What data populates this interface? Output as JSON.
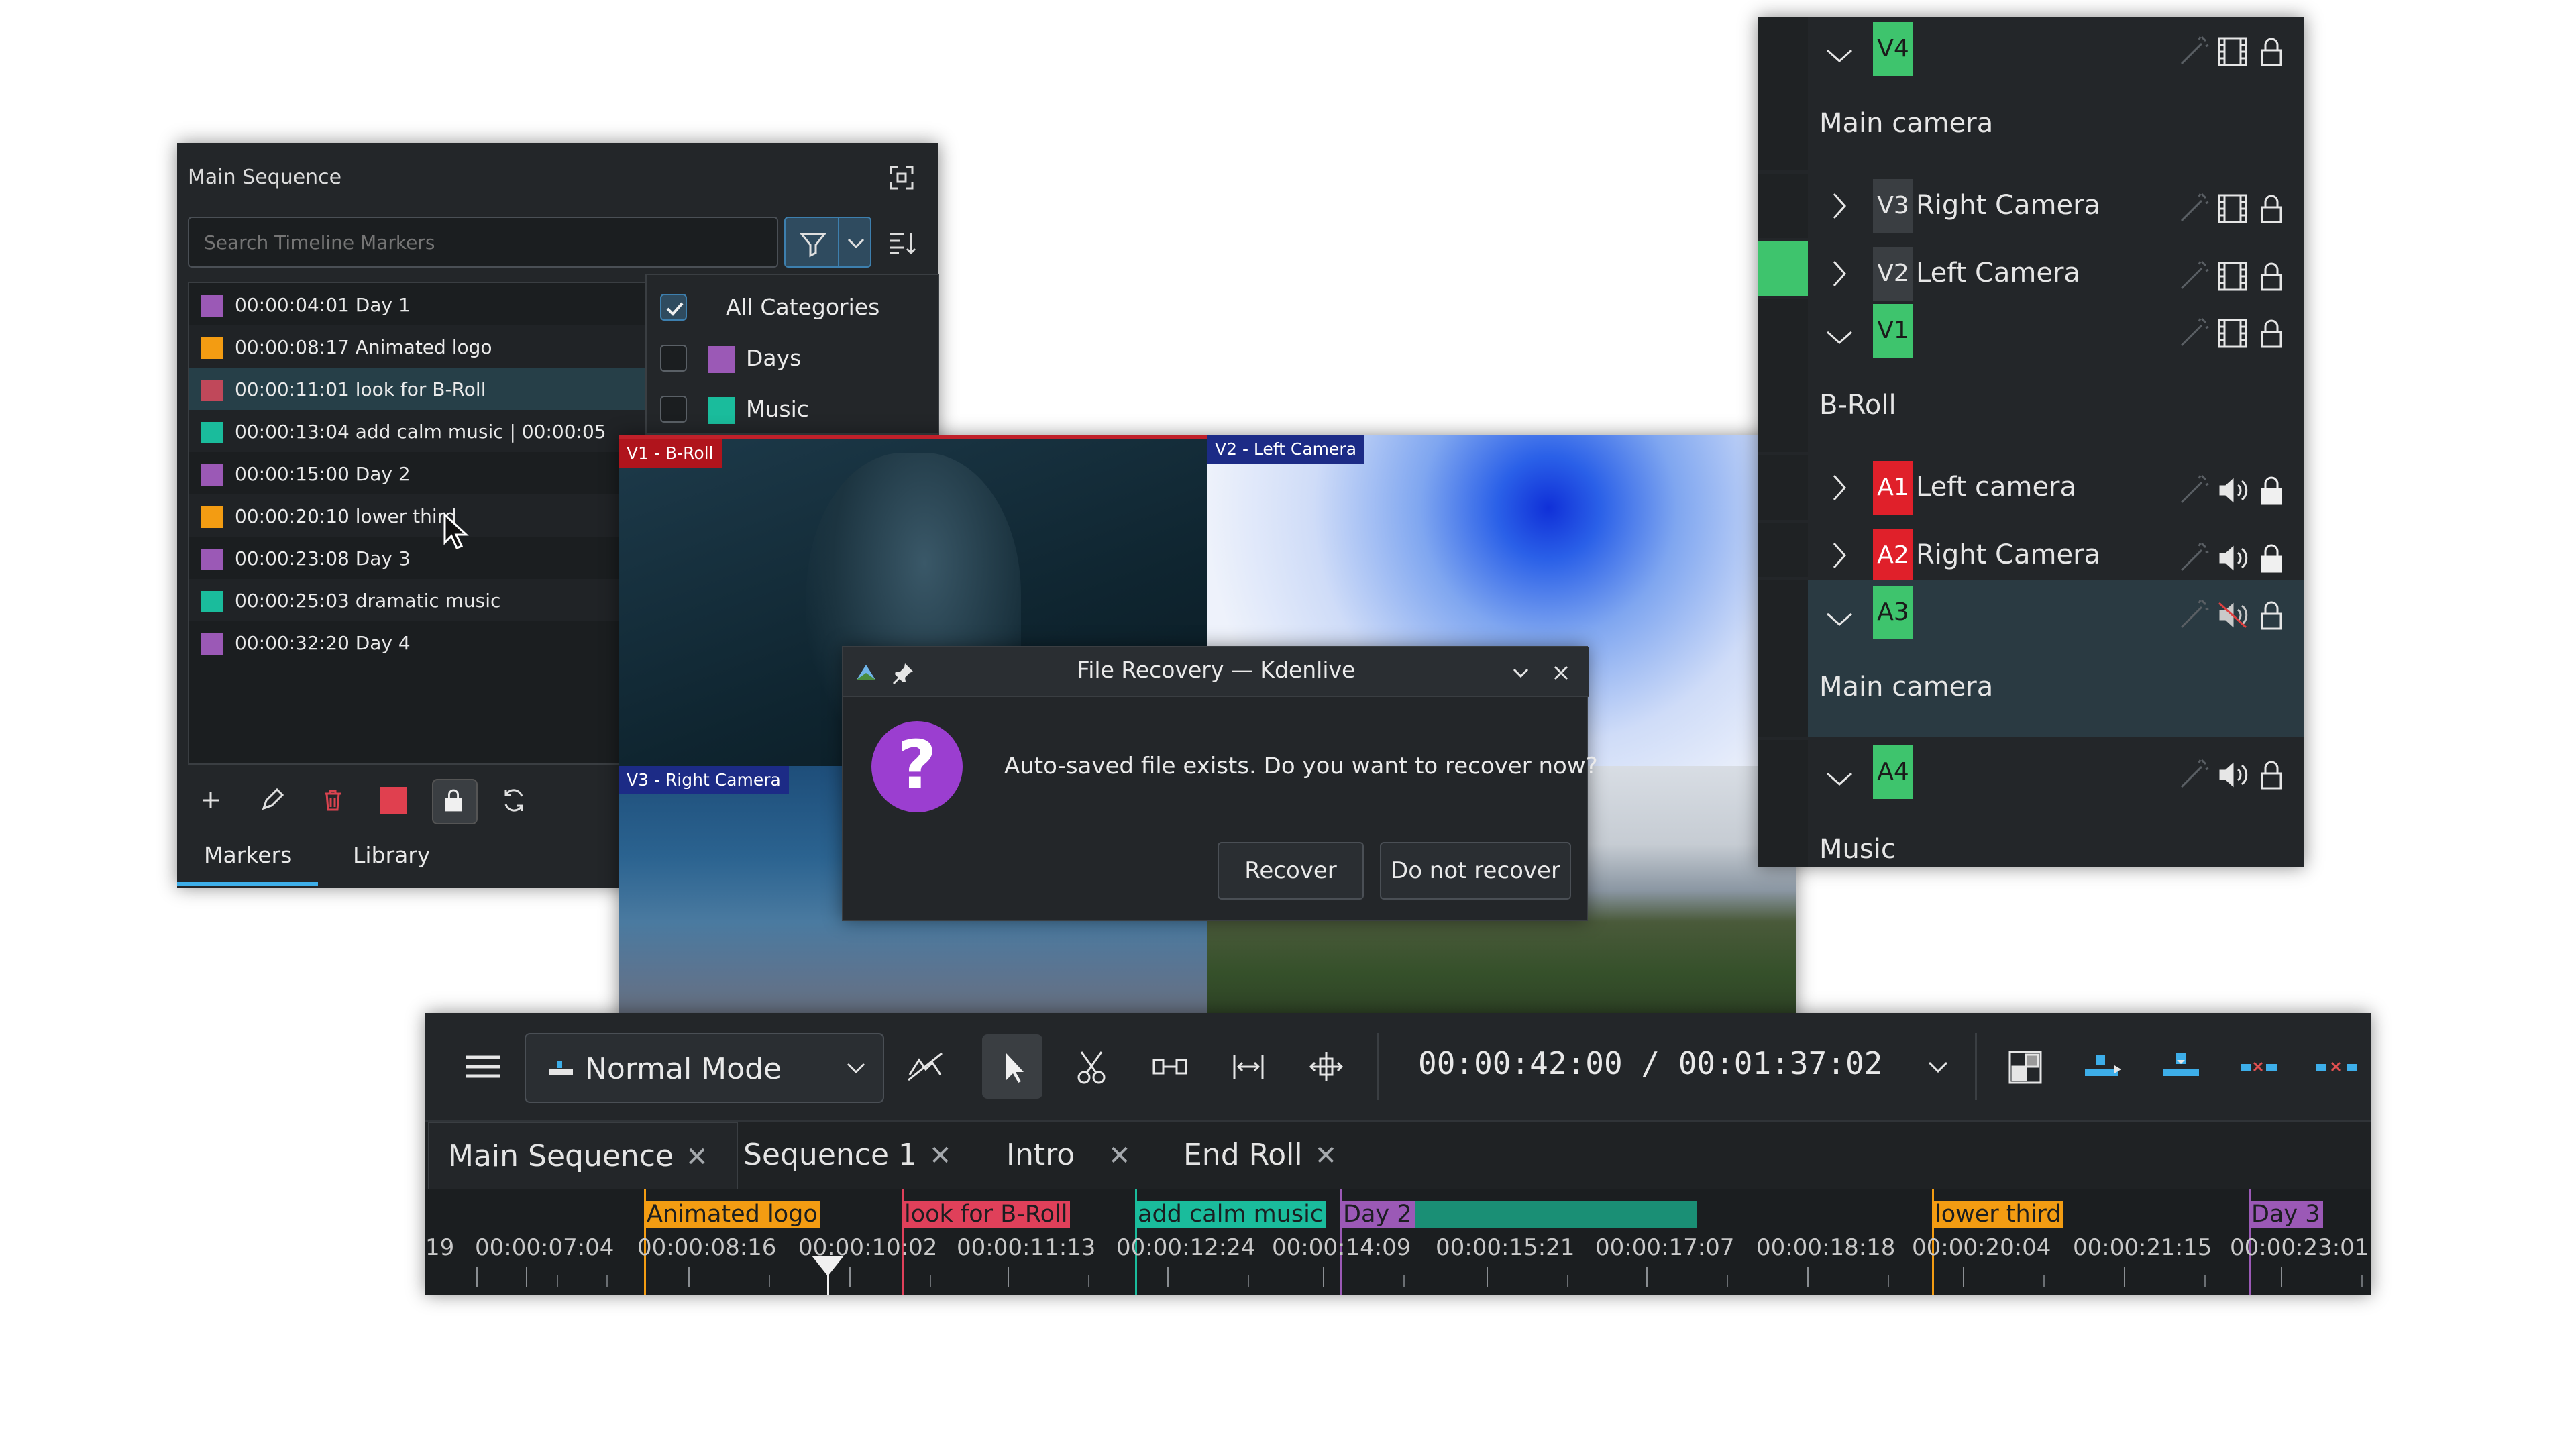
{
  "markers_panel": {
    "title": "Main Sequence",
    "search_placeholder": "Search Timeline Markers",
    "items": [
      {
        "label": "00:00:04:01 Day 1",
        "color": "#9b59b6"
      },
      {
        "label": "00:00:08:17 Animated logo",
        "color": "#f39c12"
      },
      {
        "label": "00:00:11:01 look for B-Roll",
        "color": "#c0485a"
      },
      {
        "label": "00:00:13:04 add calm music | 00:00:05",
        "color": "#1abc9c"
      },
      {
        "label": "00:00:15:00 Day 2",
        "color": "#9b59b6"
      },
      {
        "label": "00:00:20:10 lower third",
        "color": "#f39c12"
      },
      {
        "label": "00:00:23:08 Day 3",
        "color": "#9b59b6"
      },
      {
        "label": "00:00:25:03 dramatic music",
        "color": "#1abc9c"
      },
      {
        "label": "00:00:32:20 Day 4",
        "color": "#9b59b6"
      }
    ],
    "selected_index": 2,
    "tabs": [
      "Markers",
      "Library"
    ],
    "current_color": "#e0404f",
    "categories": [
      {
        "label": "All Categories",
        "checked": true,
        "color": ""
      },
      {
        "label": "Days",
        "checked": false,
        "color": "#9b59b6"
      },
      {
        "label": "Music",
        "checked": false,
        "color": "#1abc9c"
      }
    ]
  },
  "monitor": {
    "tiles": [
      "V1 - B-Roll",
      "V2 - Left Camera",
      "V3 - Right Camera"
    ]
  },
  "dialog": {
    "title": "File Recovery — Kdenlive",
    "message": "Auto-saved file exists. Do you want to recover now?",
    "recover_label": "Recover",
    "norecover_label": "Do not recover"
  },
  "tracks": [
    {
      "id": "V4",
      "name": "",
      "sub": "Main camera",
      "expanded": true,
      "type": "video",
      "color": "#3ec46d"
    },
    {
      "id": "V3",
      "name": "Right Camera",
      "sub": "",
      "expanded": false,
      "type": "video",
      "color": "#3a3e42"
    },
    {
      "id": "V2",
      "name": "Left Camera",
      "sub": "",
      "expanded": false,
      "type": "video",
      "color": "#3a3e42"
    },
    {
      "id": "V1",
      "name": "",
      "sub": "B-Roll",
      "expanded": true,
      "type": "video",
      "color": "#3ec46d"
    },
    {
      "id": "A1",
      "name": "Left camera",
      "sub": "",
      "expanded": false,
      "type": "audio",
      "color": "#e0202a"
    },
    {
      "id": "A2",
      "name": "Right Camera",
      "sub": "",
      "expanded": false,
      "type": "audio",
      "color": "#e0202a"
    },
    {
      "id": "A3",
      "name": "",
      "sub": "Main camera",
      "expanded": true,
      "type": "audio-muted",
      "color": "#3ec46d"
    },
    {
      "id": "A4",
      "name": "",
      "sub": "Music",
      "expanded": true,
      "type": "audio",
      "color": "#3ec46d"
    }
  ],
  "timeline": {
    "mode": "Normal Mode",
    "timecode": "00:00:42:00 / 00:01:37:02",
    "tabs": [
      "Main Sequence",
      "Sequence 1",
      "Intro",
      "End Roll"
    ],
    "ruler_markers": [
      {
        "label": "Animated logo",
        "color": "#f39c12"
      },
      {
        "label": "look for B-Roll",
        "color": "#e0405a"
      },
      {
        "label": "add calm music",
        "color": "#1abc9c"
      },
      {
        "label": "Day 2",
        "color": "#9b59b6"
      },
      {
        "label": "lower third",
        "color": "#f39c12"
      },
      {
        "label": "Day 3",
        "color": "#9b59b6"
      }
    ],
    "ruler_ticks": [
      "19",
      "00:00:07:04",
      "00:00:08:16",
      "00:00:10:02",
      "00:00:11:13",
      "00:00:12:24",
      "00:00:14:09",
      "00:00:15:21",
      "00:00:17:07",
      "00:00:18:18",
      "00:00:20:04",
      "00:00:21:15",
      "00:00:23:01"
    ]
  }
}
